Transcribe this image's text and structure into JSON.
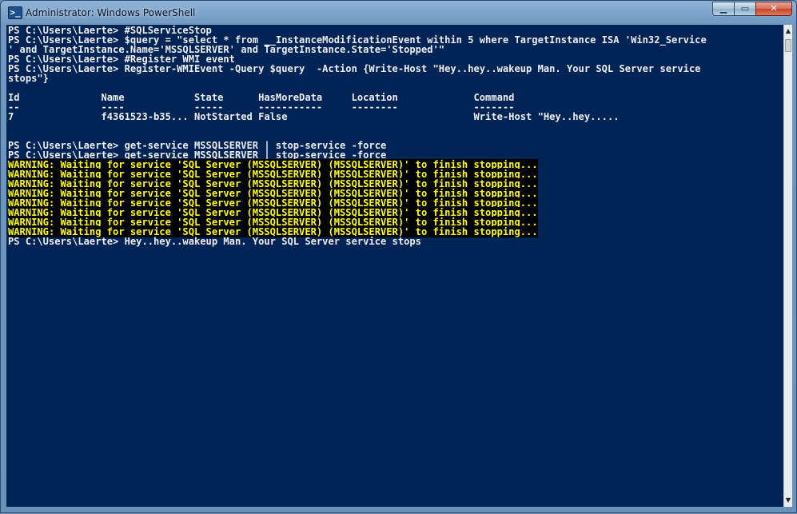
{
  "window": {
    "title": "Administrator: Windows PowerShell",
    "icon_glyph": ">_",
    "controls": {
      "minimize": "▁",
      "maximize": "▭",
      "close": "✕"
    },
    "colors": {
      "console_bg": "#012456",
      "console_fg": "#eeedf0",
      "warning_fg": "#ffff00",
      "warning_bg": "#000000"
    }
  },
  "console": {
    "lines": [
      {
        "text": "PS C:\\Users\\Laerte> #SQLServiceStop",
        "type": "normal"
      },
      {
        "text": "PS C:\\Users\\Laerte> $query = \"select * from __InstanceModificationEvent within 5 where TargetInstance ISA 'Win32_Service",
        "type": "normal"
      },
      {
        "text": "' and TargetInstance.Name='MSSQLSERVER' and TargetInstance.State='Stopped'\"",
        "type": "normal"
      },
      {
        "text": "PS C:\\Users\\Laerte> #Register WMI event",
        "type": "normal"
      },
      {
        "text": "PS C:\\Users\\Laerte> Register-WMIEvent -Query $query  -Action {Write-Host \"Hey..hey..wakeup Man. Your SQL Server service",
        "type": "normal"
      },
      {
        "text": "stops\"}",
        "type": "normal"
      },
      {
        "text": "",
        "type": "normal"
      },
      {
        "text": "Id              Name            State      HasMoreData     Location             Command",
        "type": "normal"
      },
      {
        "text": "--              ----            -----      -----------     --------             -------",
        "type": "normal"
      },
      {
        "text": "7               f4361523-b35... NotStarted False                                Write-Host \"Hey..hey.....",
        "type": "normal"
      },
      {
        "text": "",
        "type": "normal"
      },
      {
        "text": "",
        "type": "normal"
      },
      {
        "text": "PS C:\\Users\\Laerte> get-service MSSQLSERVER | stop-service -force",
        "type": "normal"
      },
      {
        "text": "PS C:\\Users\\Laerte> get-service MSSQLSERVER | stop-service -force",
        "type": "normal"
      },
      {
        "text": "WARNING: Waiting for service 'SQL Server (MSSQLSERVER) (MSSQLSERVER)' to finish stopping...",
        "type": "warning"
      },
      {
        "text": "WARNING: Waiting for service 'SQL Server (MSSQLSERVER) (MSSQLSERVER)' to finish stopping...",
        "type": "warning"
      },
      {
        "text": "WARNING: Waiting for service 'SQL Server (MSSQLSERVER) (MSSQLSERVER)' to finish stopping...",
        "type": "warning"
      },
      {
        "text": "WARNING: Waiting for service 'SQL Server (MSSQLSERVER) (MSSQLSERVER)' to finish stopping...",
        "type": "warning"
      },
      {
        "text": "WARNING: Waiting for service 'SQL Server (MSSQLSERVER) (MSSQLSERVER)' to finish stopping...",
        "type": "warning"
      },
      {
        "text": "WARNING: Waiting for service 'SQL Server (MSSQLSERVER) (MSSQLSERVER)' to finish stopping...",
        "type": "warning"
      },
      {
        "text": "WARNING: Waiting for service 'SQL Server (MSSQLSERVER) (MSSQLSERVER)' to finish stopping...",
        "type": "warning"
      },
      {
        "text": "WARNING: Waiting for service 'SQL Server (MSSQLSERVER) (MSSQLSERVER)' to finish stopping...",
        "type": "warning"
      },
      {
        "text": "PS C:\\Users\\Laerte> Hey..hey..wakeup Man. Your SQL Server service stops",
        "type": "normal"
      }
    ]
  },
  "scrollbar": {
    "up_arrow": "▲",
    "down_arrow": "▼"
  }
}
